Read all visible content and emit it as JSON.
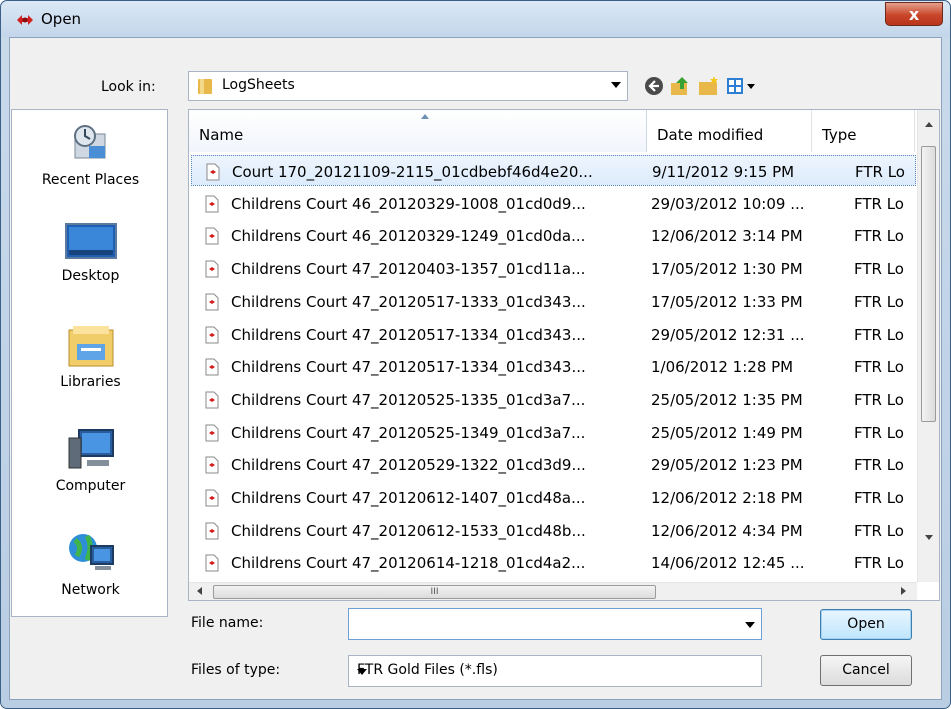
{
  "window": {
    "title": "Open",
    "close_glyph": "x",
    "colors": {
      "title_gradient_top": "#dbe8f5",
      "close_red": "#c9462b",
      "selection": "#dcebfc"
    }
  },
  "look_in": {
    "label": "Look in:",
    "value": "LogSheets"
  },
  "toolbar": [
    "back-icon",
    "up-folder-icon",
    "new-folder-icon",
    "view-menu-icon"
  ],
  "places": [
    {
      "label": "Recent Places",
      "icon": "recent-places-icon"
    },
    {
      "label": "Desktop",
      "icon": "desktop-icon"
    },
    {
      "label": "Libraries",
      "icon": "libraries-icon"
    },
    {
      "label": "Computer",
      "icon": "computer-icon"
    },
    {
      "label": "Network",
      "icon": "network-icon"
    }
  ],
  "file_list": {
    "columns": [
      "Name",
      "Date modified",
      "Type"
    ],
    "rows": [
      {
        "name": "Court 170_20121109-2115_01cdbebf46d4e20...",
        "date": "9/11/2012 9:15 PM",
        "type": "FTR Lo"
      },
      {
        "name": "Childrens Court 46_20120329-1008_01cd0d9...",
        "date": "29/03/2012 10:09 ...",
        "type": "FTR Lo"
      },
      {
        "name": "Childrens Court 46_20120329-1249_01cd0da...",
        "date": "12/06/2012 3:14 PM",
        "type": "FTR Lo"
      },
      {
        "name": "Childrens Court 47_20120403-1357_01cd11a...",
        "date": "17/05/2012 1:30 PM",
        "type": "FTR Lo"
      },
      {
        "name": "Childrens Court 47_20120517-1333_01cd343...",
        "date": "17/05/2012 1:33 PM",
        "type": "FTR Lo"
      },
      {
        "name": "Childrens Court 47_20120517-1334_01cd343...",
        "date": "29/05/2012 12:31 ...",
        "type": "FTR Lo"
      },
      {
        "name": "Childrens Court 47_20120517-1334_01cd343...",
        "date": "1/06/2012 1:28 PM",
        "type": "FTR Lo"
      },
      {
        "name": "Childrens Court 47_20120525-1335_01cd3a7...",
        "date": "25/05/2012 1:35 PM",
        "type": "FTR Lo"
      },
      {
        "name": "Childrens Court 47_20120525-1349_01cd3a7...",
        "date": "25/05/2012 1:49 PM",
        "type": "FTR Lo"
      },
      {
        "name": "Childrens Court 47_20120529-1322_01cd3d9...",
        "date": "29/05/2012 1:23 PM",
        "type": "FTR Lo"
      },
      {
        "name": "Childrens Court 47_20120612-1407_01cd48a...",
        "date": "12/06/2012 2:18 PM",
        "type": "FTR Lo"
      },
      {
        "name": "Childrens Court 47_20120612-1533_01cd48b...",
        "date": "12/06/2012 4:34 PM",
        "type": "FTR Lo"
      },
      {
        "name": "Childrens Court 47_20120614-1218_01cd4a2...",
        "date": "14/06/2012 12:45 ...",
        "type": "FTR Lo"
      }
    ],
    "selected_index": 0,
    "hscroll_grip": "III"
  },
  "file_name": {
    "label": "File name:",
    "value": ""
  },
  "files_of_type": {
    "label": "Files of type:",
    "value": "FTR Gold Files (*.fls)"
  },
  "buttons": {
    "open": "Open",
    "cancel": "Cancel"
  }
}
